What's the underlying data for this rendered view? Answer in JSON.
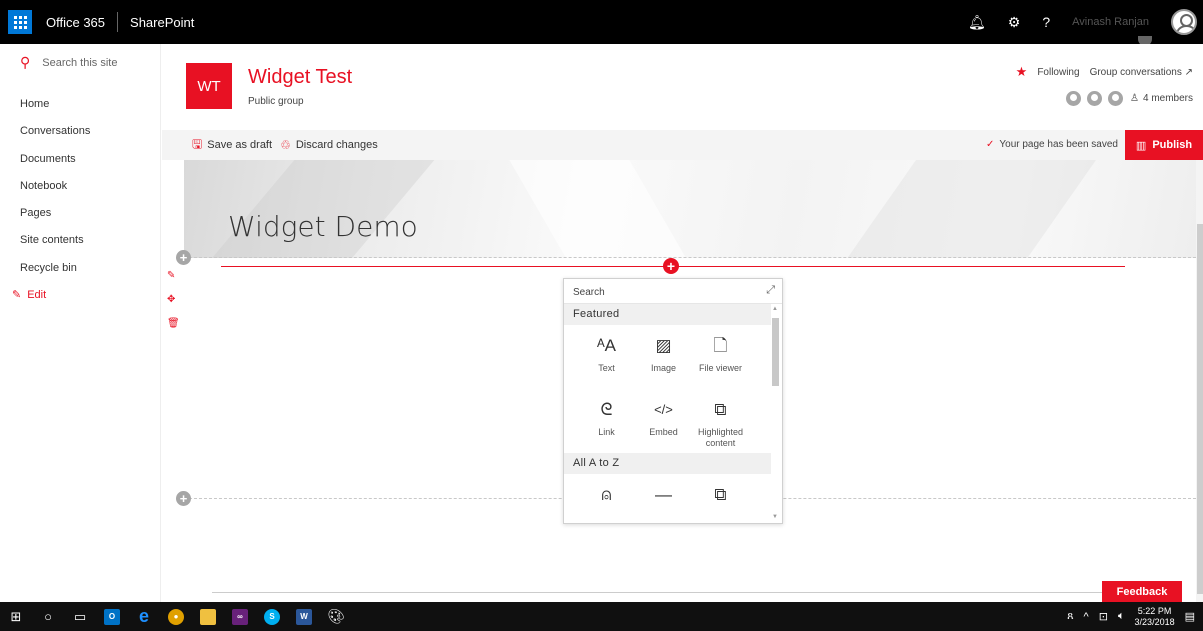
{
  "suite": {
    "office": "Office 365",
    "product": "SharePoint",
    "user": "Avinash Ranjan",
    "help": "?"
  },
  "nav": {
    "search_placeholder": "Search this site",
    "items": [
      "Home",
      "Conversations",
      "Documents",
      "Notebook",
      "Pages",
      "Site contents",
      "Recycle bin"
    ],
    "edit": "Edit"
  },
  "site": {
    "logo": "WT",
    "title": "Widget Test",
    "subtitle": "Public group",
    "following": "Following",
    "group_conversations": "Group conversations ↗",
    "members": "4 members"
  },
  "cmd": {
    "save_draft": "Save as draft",
    "discard": "Discard changes",
    "saved_status": "Your page has been saved",
    "publish": "Publish"
  },
  "page": {
    "title": "Widget Demo"
  },
  "toolbox": {
    "search": "Search",
    "featured": "Featured",
    "featured_items": [
      {
        "label": "Text",
        "icon": "text-icon",
        "glyph": "ᴬA"
      },
      {
        "label": "Image",
        "icon": "image-icon",
        "glyph": "▨"
      },
      {
        "label": "File viewer",
        "icon": "file-icon",
        "glyph": "🗋"
      },
      {
        "label": "Link",
        "icon": "link-icon",
        "glyph": "ᘓ"
      },
      {
        "label": "Embed",
        "icon": "embed-icon",
        "glyph": "</>"
      },
      {
        "label": "Highlighted content",
        "icon": "highlighted-content-icon",
        "glyph": "⧉"
      }
    ],
    "all_az": "All A to Z",
    "az_items": [
      {
        "label": "",
        "icon": "bing-maps-icon",
        "glyph": "⍝"
      },
      {
        "label": "",
        "icon": "divider-icon",
        "glyph": "—"
      },
      {
        "label": "",
        "icon": "document-library-icon",
        "glyph": "⧉"
      }
    ]
  },
  "feedback": "Feedback",
  "taskbar": {
    "time": "5:22 PM",
    "date": "3/23/2018"
  }
}
